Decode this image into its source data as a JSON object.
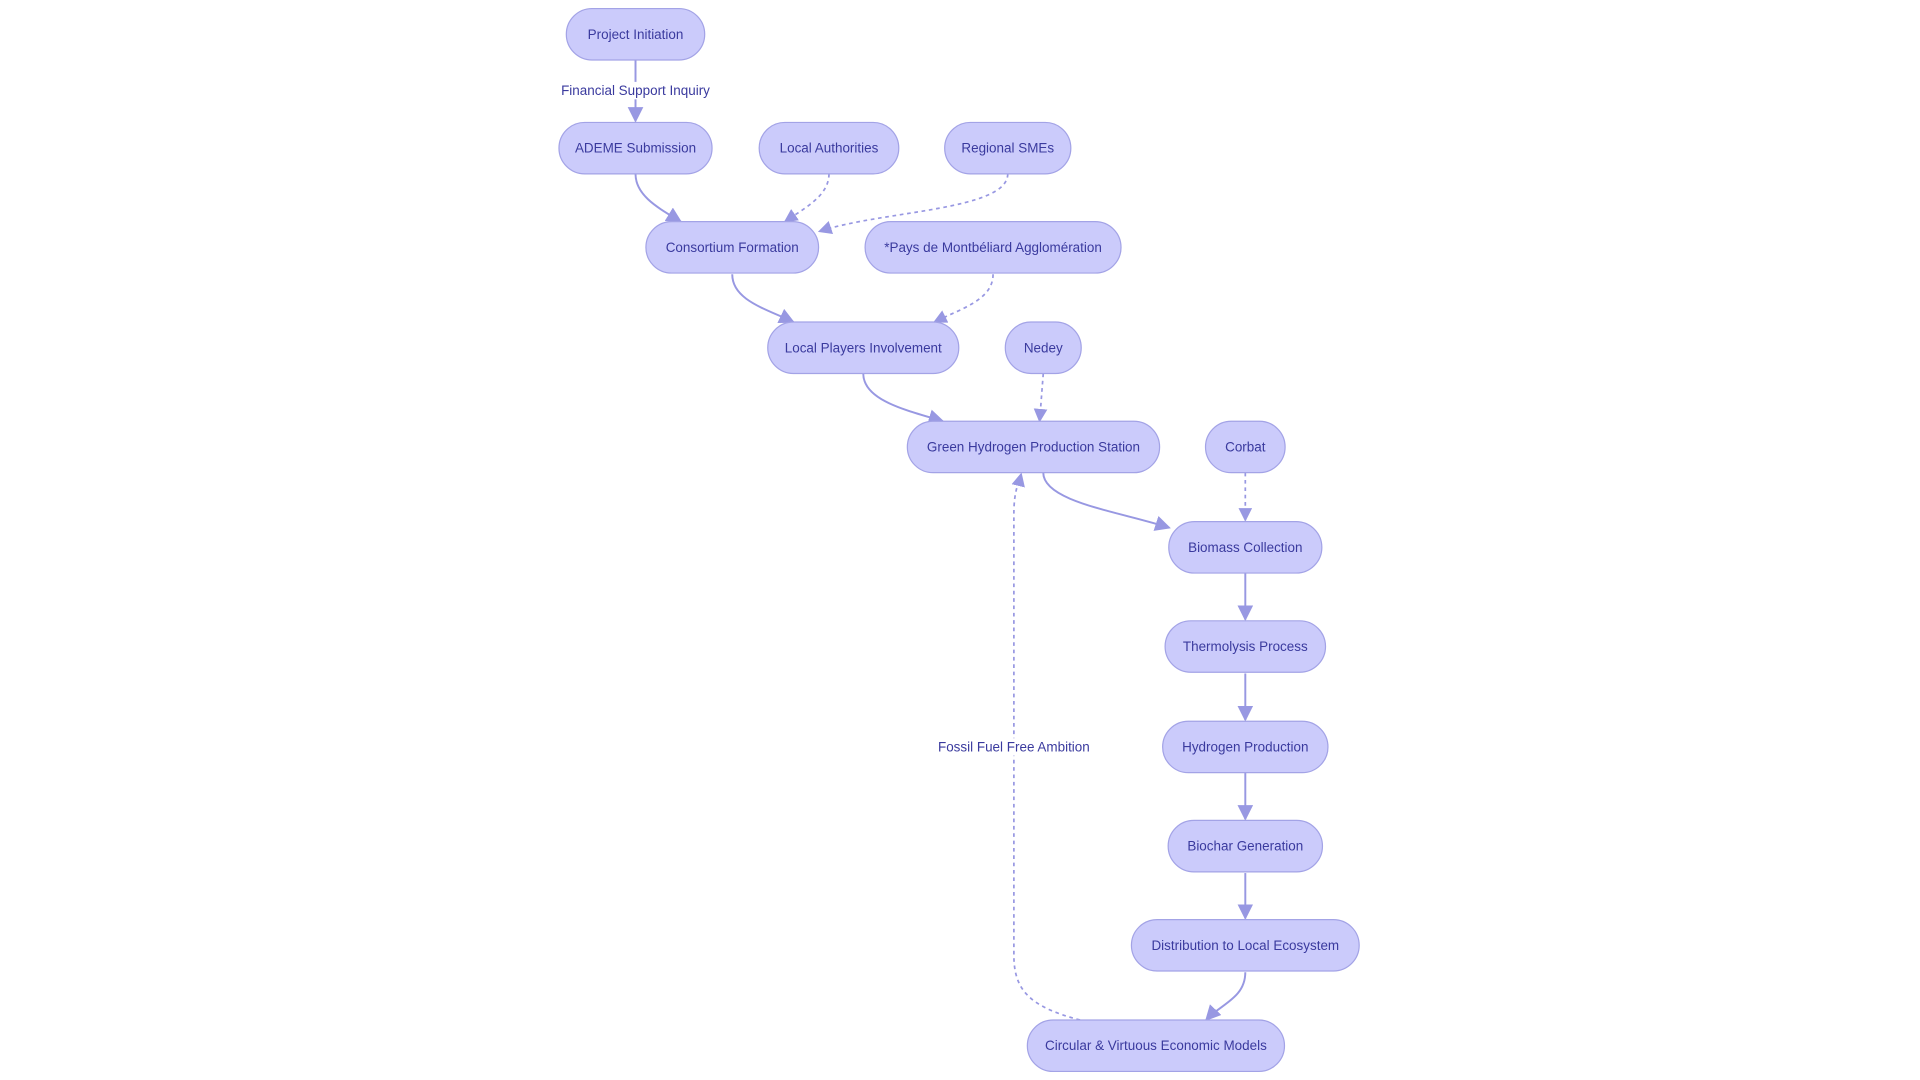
{
  "diagram": {
    "colors": {
      "node_fill": "#cbcbfb",
      "node_stroke": "#a3a3e6",
      "text": "#3a3a9e",
      "edge": "#9898e2",
      "background": "#ffffff"
    },
    "nodes": [
      {
        "id": "project-initiation",
        "label": "Project Initiation"
      },
      {
        "id": "ademe-submission",
        "label": "ADEME Submission"
      },
      {
        "id": "local-authorities",
        "label": "Local Authorities"
      },
      {
        "id": "regional-smes",
        "label": "Regional SMEs"
      },
      {
        "id": "consortium-formation",
        "label": "Consortium Formation"
      },
      {
        "id": "pays-de-montbeliard",
        "label": "*Pays de Montbéliard Agglomération"
      },
      {
        "id": "local-players-involvement",
        "label": "Local Players Involvement"
      },
      {
        "id": "nedey",
        "label": "Nedey"
      },
      {
        "id": "green-hydrogen-station",
        "label": "Green Hydrogen Production Station"
      },
      {
        "id": "corbat",
        "label": "Corbat"
      },
      {
        "id": "biomass-collection",
        "label": "Biomass Collection"
      },
      {
        "id": "thermolysis-process",
        "label": "Thermolysis Process"
      },
      {
        "id": "hydrogen-production",
        "label": "Hydrogen Production"
      },
      {
        "id": "biochar-generation",
        "label": "Biochar Generation"
      },
      {
        "id": "distribution-local-ecosystem",
        "label": "Distribution to Local Ecosystem"
      },
      {
        "id": "circular-economic-models",
        "label": "Circular & Virtuous Economic Models"
      }
    ],
    "edges": [
      {
        "from": "project-initiation",
        "to": "ademe-submission",
        "style": "solid",
        "label": "Financial Support Inquiry"
      },
      {
        "from": "ademe-submission",
        "to": "consortium-formation",
        "style": "solid"
      },
      {
        "from": "local-authorities",
        "to": "consortium-formation",
        "style": "dotted"
      },
      {
        "from": "regional-smes",
        "to": "consortium-formation",
        "style": "dotted"
      },
      {
        "from": "consortium-formation",
        "to": "local-players-involvement",
        "style": "solid"
      },
      {
        "from": "pays-de-montbeliard",
        "to": "local-players-involvement",
        "style": "dotted"
      },
      {
        "from": "local-players-involvement",
        "to": "green-hydrogen-station",
        "style": "solid"
      },
      {
        "from": "nedey",
        "to": "green-hydrogen-station",
        "style": "dotted"
      },
      {
        "from": "green-hydrogen-station",
        "to": "biomass-collection",
        "style": "solid"
      },
      {
        "from": "corbat",
        "to": "biomass-collection",
        "style": "dotted"
      },
      {
        "from": "biomass-collection",
        "to": "thermolysis-process",
        "style": "solid"
      },
      {
        "from": "thermolysis-process",
        "to": "hydrogen-production",
        "style": "solid"
      },
      {
        "from": "hydrogen-production",
        "to": "biochar-generation",
        "style": "solid"
      },
      {
        "from": "biochar-generation",
        "to": "distribution-local-ecosystem",
        "style": "solid"
      },
      {
        "from": "distribution-local-ecosystem",
        "to": "circular-economic-models",
        "style": "solid"
      },
      {
        "from": "circular-economic-models",
        "to": "green-hydrogen-station",
        "style": "dotted",
        "label": "Fossil Fuel Free Ambition"
      }
    ]
  }
}
